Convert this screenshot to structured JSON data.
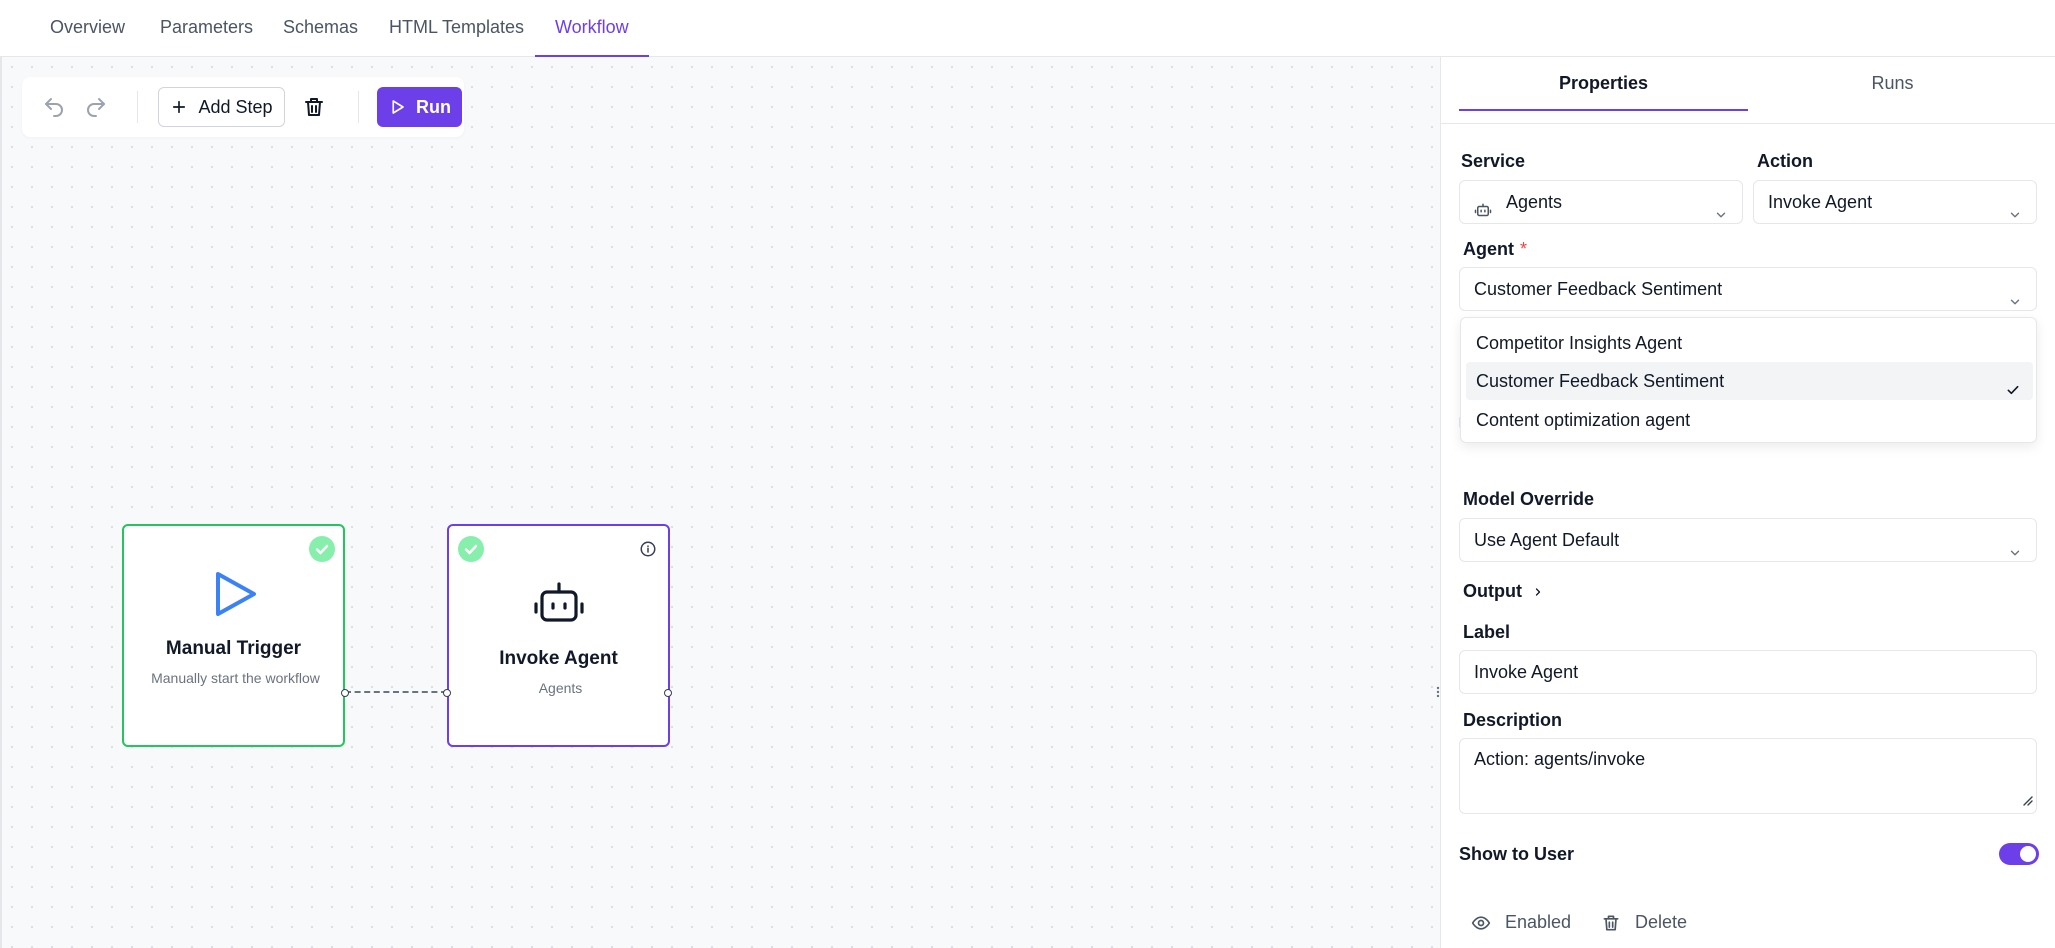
{
  "tabs": [
    "Overview",
    "Parameters",
    "Schemas",
    "HTML Templates",
    "Workflow"
  ],
  "active_tab": "Workflow",
  "toolbar": {
    "add_step_label": "Add Step",
    "run_label": "Run"
  },
  "nodes": {
    "trigger": {
      "title": "Manual Trigger",
      "subtitle": "Manually start the workflow"
    },
    "agent": {
      "title": "Invoke Agent",
      "subtitle": "Agents"
    }
  },
  "panel": {
    "tabs": [
      "Properties",
      "Runs"
    ],
    "active_tab": "Properties",
    "service": {
      "label": "Service",
      "value": "Agents",
      "icon": "robot-icon"
    },
    "action": {
      "label": "Action",
      "value": "Invoke Agent"
    },
    "agent": {
      "label": "Agent",
      "required_mark": "*",
      "value": "Customer Feedback Sentiment",
      "options": [
        "Competitor Insights Agent",
        "Customer Feedback Sentiment",
        "Content optimization agent"
      ],
      "selected_index": 1
    },
    "model_override": {
      "label": "Model Override",
      "value": "Use Agent Default"
    },
    "output": {
      "label": "Output"
    },
    "label_field": {
      "label": "Label",
      "value": "Invoke Agent"
    },
    "description": {
      "label": "Description",
      "value": "Action: agents/invoke"
    },
    "show_to_user": {
      "label": "Show to User",
      "enabled": true
    },
    "footer": {
      "enabled_label": "Enabled",
      "delete_label": "Delete"
    }
  },
  "colors": {
    "accent": "#6d3fe8",
    "success": "#22c55e",
    "success_light": "#86efac",
    "required": "#ef4444"
  }
}
